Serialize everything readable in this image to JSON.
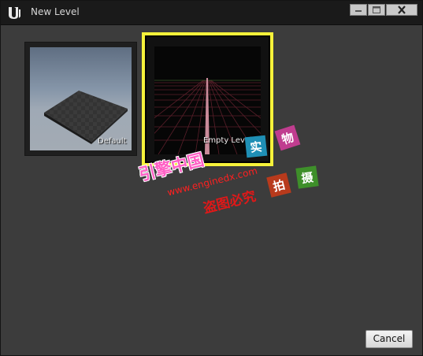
{
  "window": {
    "title": "New Level",
    "controls": {
      "minimize": "minimize-icon",
      "maximize": "maximize-icon",
      "close": "close-icon"
    }
  },
  "templates": [
    {
      "label": "Default",
      "selected": false
    },
    {
      "label": "Empty Level",
      "selected": true
    }
  ],
  "watermark": {
    "main": "引擎中国",
    "url": "www.enginedx.com",
    "sub": "盗图必究",
    "stamps": [
      "实",
      "物",
      "拍",
      "摄"
    ]
  },
  "footer": {
    "cancel_label": "Cancel"
  },
  "colors": {
    "selection": "#f6f23a",
    "background": "#3c3c3c",
    "titlebar": "#1a1a1a"
  }
}
